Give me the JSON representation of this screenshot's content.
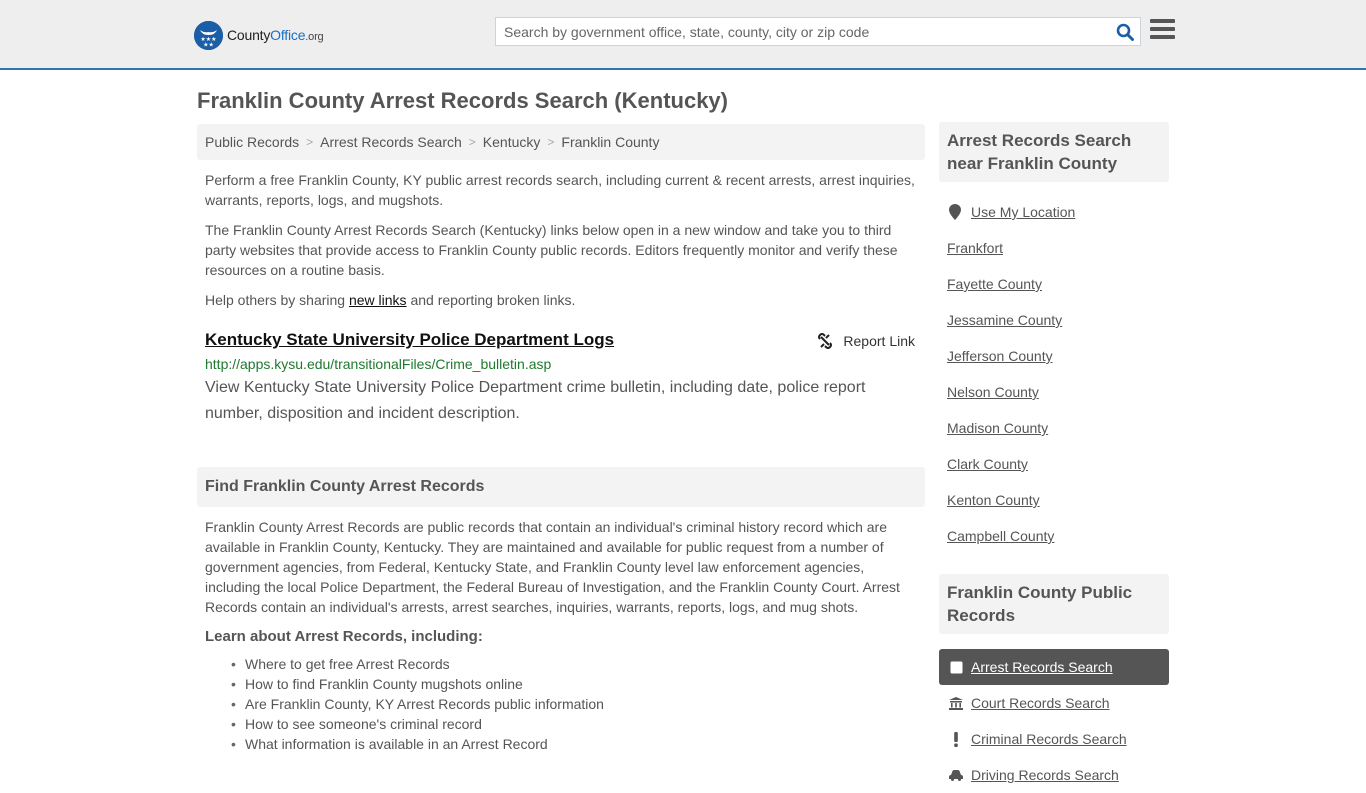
{
  "header": {
    "logo": {
      "name_part1": "County",
      "name_part2": "Office",
      "tld": ".org"
    },
    "search": {
      "placeholder": "Search by government office, state, county, city or zip code",
      "value": ""
    },
    "colors": {
      "accent": "#2e75b6",
      "brand_blue": "#1a5ea8"
    }
  },
  "page": {
    "title": "Franklin County Arrest Records Search (Kentucky)"
  },
  "breadcrumb": [
    {
      "label": "Public Records"
    },
    {
      "label": "Arrest Records Search"
    },
    {
      "label": "Kentucky"
    },
    {
      "label": "Franklin County"
    }
  ],
  "intro": {
    "p1": "Perform a free Franklin County, KY public arrest records search, including current & recent arrests, arrest inquiries, warrants, reports, logs, and mugshots.",
    "p2": "The Franklin County Arrest Records Search (Kentucky) links below open in a new window and take you to third party websites that provide access to Franklin County public records. Editors frequently monitor and verify these resources on a routine basis.",
    "p3_before": "Help others by sharing ",
    "p3_link": "new links",
    "p3_after": " and reporting broken links."
  },
  "results": [
    {
      "title": "Kentucky State University Police Department Logs",
      "url": "http://apps.kysu.edu/transitionalFiles/Crime_bulletin.asp",
      "description": "View Kentucky State University Police Department crime bulletin, including date, police report number, disposition and incident description.",
      "report_label": "Report Link"
    }
  ],
  "find_section": {
    "heading": "Find Franklin County Arrest Records",
    "body": "Franklin County Arrest Records are public records that contain an individual's criminal history record which are available in Franklin County, Kentucky. They are maintained and available for public request from a number of government agencies, from Federal, Kentucky State, and Franklin County level law enforcement agencies, including the local Police Department, the Federal Bureau of Investigation, and the Franklin County Court. Arrest Records contain an individual's arrests, arrest searches, inquiries, warrants, reports, logs, and mug shots.",
    "learn_heading": "Learn about Arrest Records, including:",
    "learn_items": [
      "Where to get free Arrest Records",
      "How to find Franklin County mugshots online",
      "Are Franklin County, KY Arrest Records public information",
      "How to see someone's criminal record",
      "What information is available in an Arrest Record"
    ]
  },
  "sidebar": {
    "nearby_heading": "Arrest Records Search near Franklin County",
    "use_location": "Use My Location",
    "nearby": [
      "Frankfort",
      "Fayette County",
      "Jessamine County",
      "Jefferson County",
      "Nelson County",
      "Madison County",
      "Clark County",
      "Kenton County",
      "Campbell County"
    ],
    "public_records_heading": "Franklin County Public Records",
    "public_records": [
      {
        "label": "Arrest Records Search",
        "icon": "square-icon",
        "active": true
      },
      {
        "label": "Court Records Search",
        "icon": "courthouse-icon",
        "active": false
      },
      {
        "label": "Criminal Records Search",
        "icon": "exclamation-icon",
        "active": false
      },
      {
        "label": "Driving Records Search",
        "icon": "car-icon",
        "active": false
      }
    ]
  }
}
